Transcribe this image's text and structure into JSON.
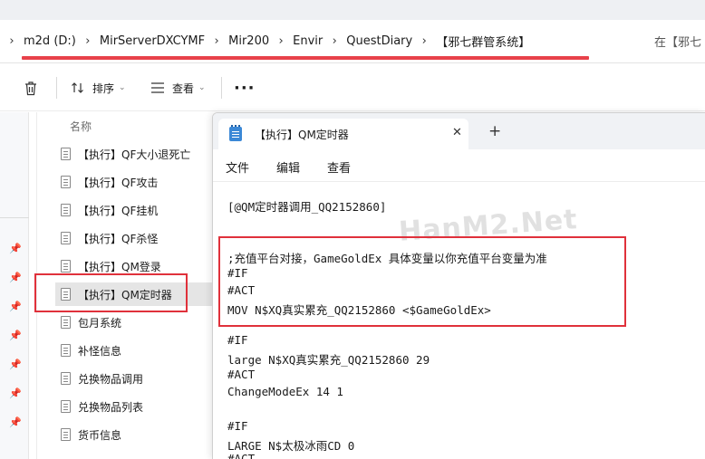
{
  "breadcrumb": {
    "items": [
      "m2d (D:)",
      "MirServerDXCYMF",
      "Mir200",
      "Envir",
      "QuestDiary",
      "【邪七群管系统】"
    ],
    "separator": "›",
    "search_label": "在【邪七"
  },
  "toolbar": {
    "sort_label": "排序",
    "view_label": "查看",
    "more_label": "···"
  },
  "filelist": {
    "column_header": "名称",
    "files": [
      {
        "name": "【执行】QF大小退死亡",
        "selected": false
      },
      {
        "name": "【执行】QF攻击",
        "selected": false
      },
      {
        "name": "【执行】QF挂机",
        "selected": false
      },
      {
        "name": "【执行】QF杀怪",
        "selected": false
      },
      {
        "name": "【执行】QM登录",
        "selected": false
      },
      {
        "name": "【执行】QM定时器",
        "selected": true
      },
      {
        "name": "包月系统",
        "selected": false
      },
      {
        "name": "补怪信息",
        "selected": false
      },
      {
        "name": "兑换物品调用",
        "selected": false
      },
      {
        "name": "兑换物品列表",
        "selected": false
      },
      {
        "name": "货币信息",
        "selected": false
      }
    ]
  },
  "notepad": {
    "tab_title": "【执行】QM定时器",
    "close_glyph": "✕",
    "new_tab_glyph": "+",
    "menus": [
      "文件",
      "编辑",
      "查看"
    ],
    "lines": [
      "[@QM定时器调用_QQ2152860]",
      "",
      ";充值平台对接，GameGoldEx 具体变量以你充值平台变量为准",
      "#IF",
      "#ACT",
      "MOV N$XQ真实累充_QQ2152860 <$GameGoldEx>",
      "",
      "#IF",
      "large N$XQ真实累充_QQ2152860 29",
      "#ACT",
      "ChangeModeEx 14 1",
      "",
      "#IF",
      "LARGE N$太极冰雨CD 0",
      "#ACT"
    ]
  },
  "watermark": "HanM2.Net",
  "colors": {
    "highlight_red": "#e0313b",
    "underline_red": "#e8414a",
    "notepad_icon_blue": "#3b88d6"
  }
}
